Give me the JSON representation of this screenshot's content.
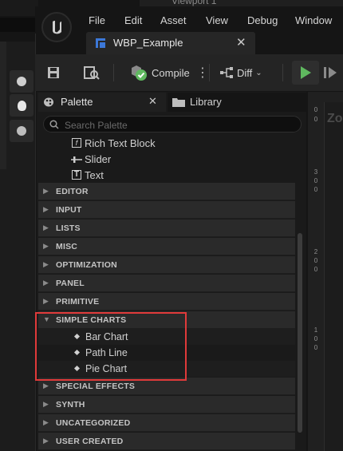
{
  "background": {
    "behind_tab_title": "Viewport 1"
  },
  "menubar": {
    "items": [
      "File",
      "Edit",
      "Asset",
      "View",
      "Debug",
      "Window"
    ]
  },
  "document_tab": {
    "title": "WBP_Example",
    "close": "✕"
  },
  "toolbar": {
    "compile_label": "Compile",
    "diff_label": "Diff",
    "more": "⋮"
  },
  "palette": {
    "tab_label": "Palette",
    "tab_close": "✕",
    "library_label": "Library",
    "search_placeholder": "Search Palette",
    "items": [
      "Rich Text Block",
      "Slider",
      "Text"
    ],
    "categories_before": [
      "EDITOR",
      "INPUT",
      "LISTS",
      "MISC",
      "OPTIMIZATION",
      "PANEL",
      "PRIMITIVE"
    ],
    "open_category": "SIMPLE CHARTS",
    "open_items": [
      "Bar Chart",
      "Path Line",
      "Pie Chart"
    ],
    "categories_after": [
      "SPECIAL EFFECTS",
      "SYNTH",
      "UNCATEGORIZED",
      "USER CREATED"
    ]
  },
  "designer": {
    "zoom_label": "Zo",
    "ruler": [
      "0",
      "0",
      "3",
      "0",
      "0",
      "2",
      "0",
      "0",
      "1",
      "0",
      "0"
    ]
  },
  "colors": {
    "highlight": "#e03a3a",
    "play": "#5fb85f",
    "accent_blue": "#3c78d8"
  }
}
